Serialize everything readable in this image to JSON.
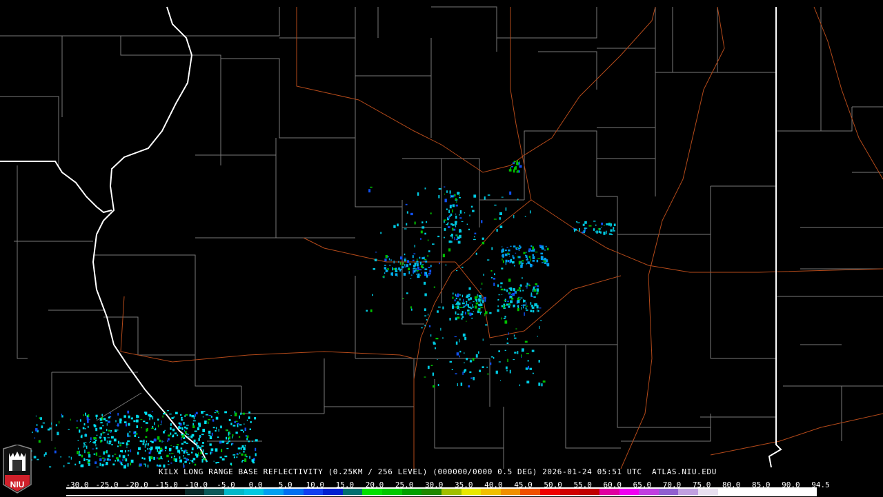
{
  "product": {
    "title": "KILX LONG RANGE BASE REFLECTIVITY (0.25KM / 256 LEVEL) (000000/0000 0.5 DEG) 2026-01-24 05:51 UTC  ATLAS.NIU.EDU"
  },
  "logo": {
    "text": "NIU",
    "icon": "niu-shield-logo"
  },
  "scale": {
    "labels": [
      "-30.0",
      "-25.0",
      "-20.0",
      "-15.0",
      "-10.0",
      "-5.0",
      "0.0",
      "5.0",
      "10.0",
      "15.0",
      "20.0",
      "25.0",
      "30.0",
      "35.0",
      "40.0",
      "45.0",
      "50.0",
      "55.0",
      "60.0",
      "65.0",
      "70.0",
      "75.0",
      "80.0",
      "85.0",
      "90.0",
      "94.5"
    ],
    "colors": [
      "#000000",
      "#000000",
      "#000000",
      "#000000",
      "#000000",
      "#000000",
      "#0a2a2a",
      "#0d5a5a",
      "#00b8c8",
      "#00c8e0",
      "#00a0f0",
      "#0070f0",
      "#1040f0",
      "#0020d0",
      "#007070",
      "#00e000",
      "#00c800",
      "#00a000",
      "#208800",
      "#a0c000",
      "#e8e800",
      "#f0c000",
      "#f09000",
      "#f05000",
      "#f00000",
      "#d00000",
      "#c00000",
      "#e000a0",
      "#f000f0",
      "#c040e0",
      "#9060d0",
      "#c0a0e0",
      "#e8e0f0",
      "#ffffff",
      "#ffffff",
      "#ffffff",
      "#ffffff",
      "#ffffff"
    ],
    "unit_min": -30.0,
    "unit_max": 94.5
  },
  "colors": {
    "state_border": "#ffffff",
    "county_border": "#8a8a8a",
    "highway": "#c0501c",
    "background": "#000000"
  }
}
